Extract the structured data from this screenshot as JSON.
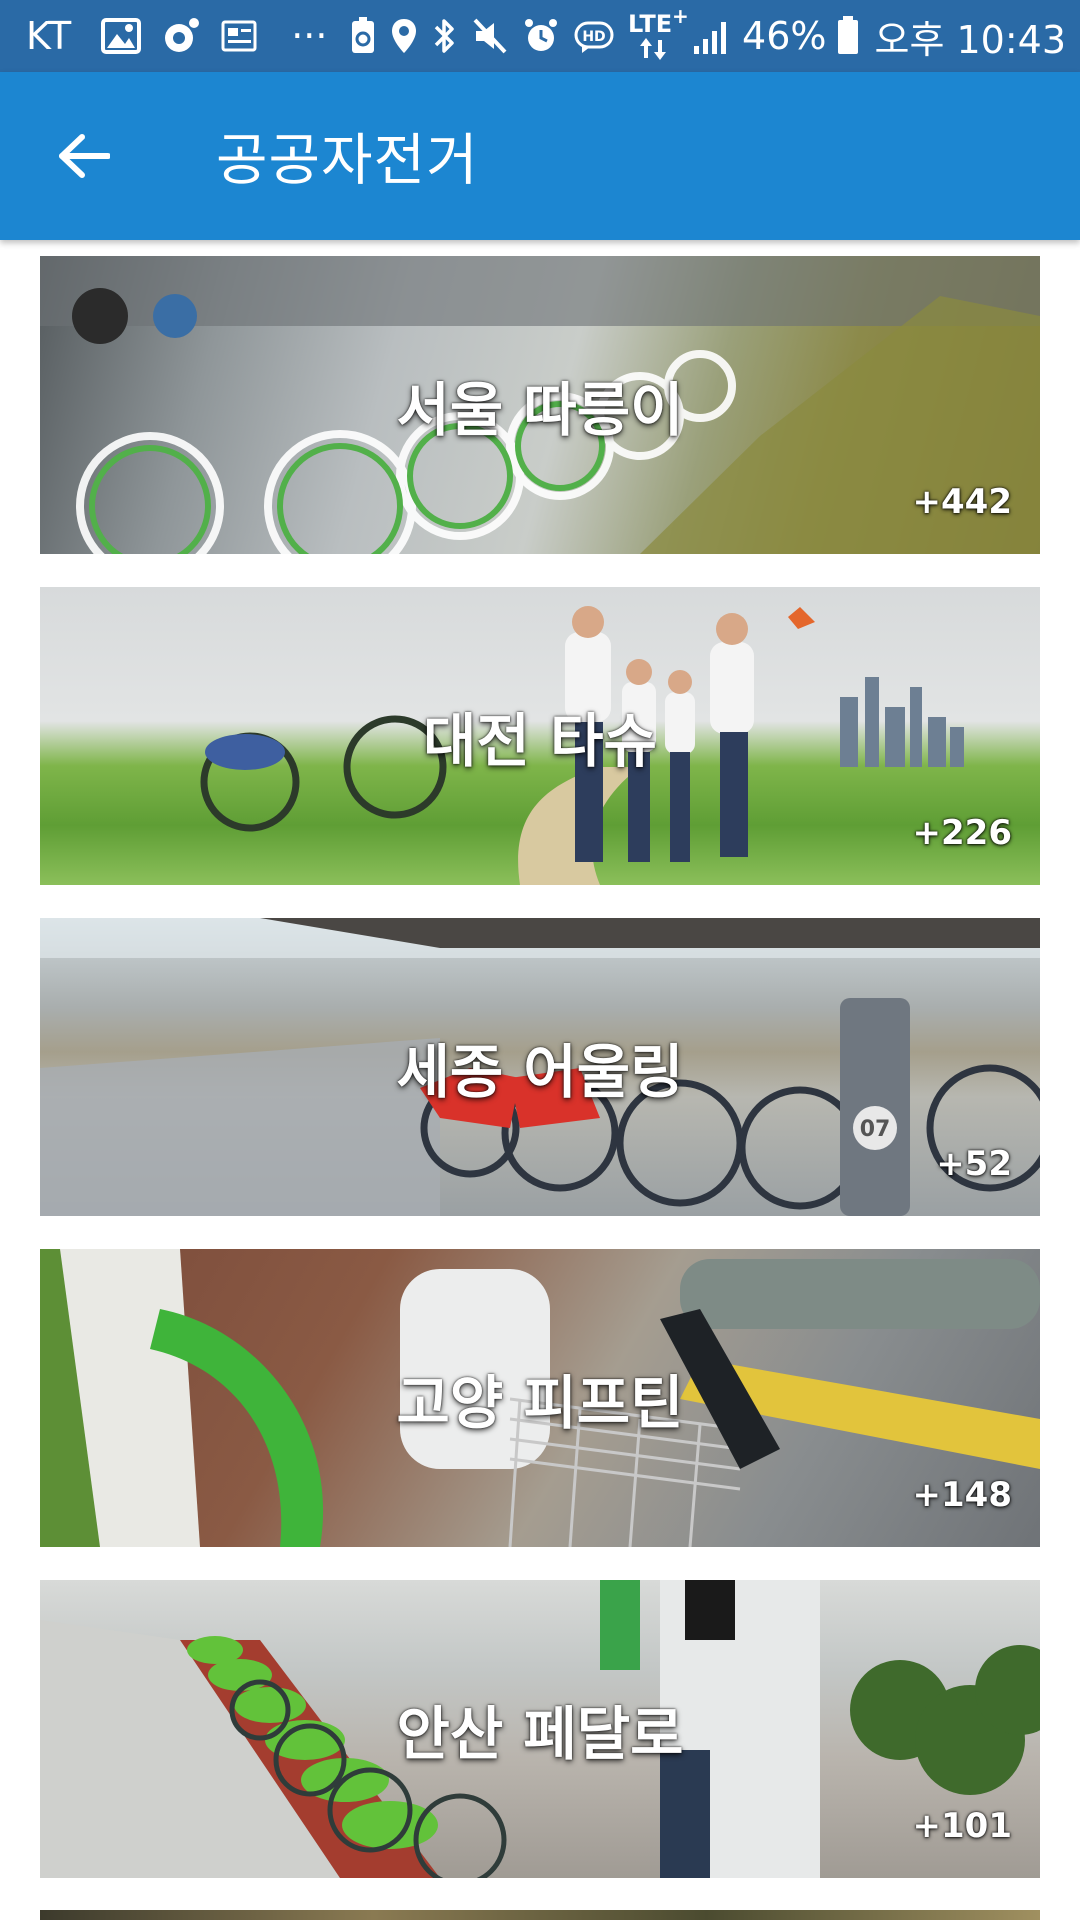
{
  "status_bar": {
    "carrier": "KT",
    "ellipsis": "···",
    "network": "LTE",
    "network_plus": "+",
    "battery": "46%",
    "time": "오후 10:43"
  },
  "app_bar": {
    "title": "공공자전거"
  },
  "cards": [
    {
      "title": "서울 따릉이",
      "count": "+442"
    },
    {
      "title": "대전 타슈",
      "count": "+226"
    },
    {
      "title": "세종 어울링",
      "count": "+52"
    },
    {
      "title": "고양 피프틴",
      "count": "+148"
    },
    {
      "title": "안산 페달로",
      "count": "+101"
    }
  ],
  "colors": {
    "status_bar": "#2a6aa6",
    "app_bar": "#1c86d1",
    "text": "#ffffff"
  }
}
